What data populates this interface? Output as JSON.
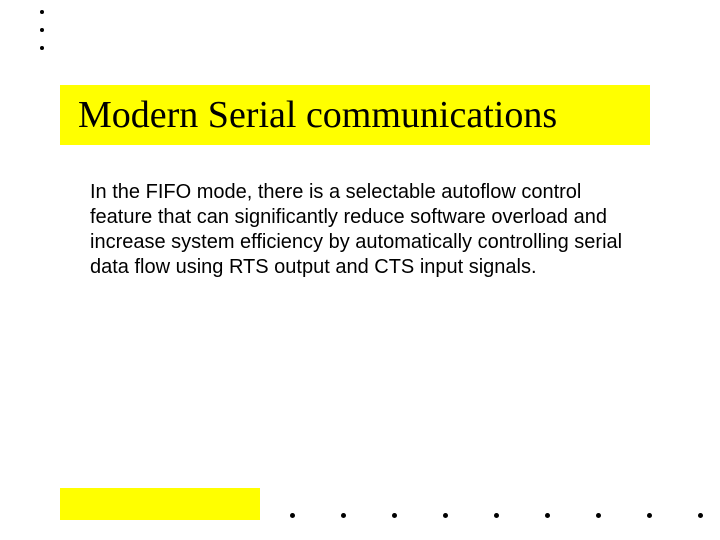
{
  "slide": {
    "title": "Modern Serial communications",
    "body": "In the FIFO mode, there is a selectable autoflow control feature that can significantly reduce software overload and increase system efficiency by automatically controlling serial data flow using RTS output and CTS input signals."
  },
  "decor": {
    "top_dot_count": 3,
    "bottom_dot_count": 9,
    "accent_color": "#ffff00"
  }
}
